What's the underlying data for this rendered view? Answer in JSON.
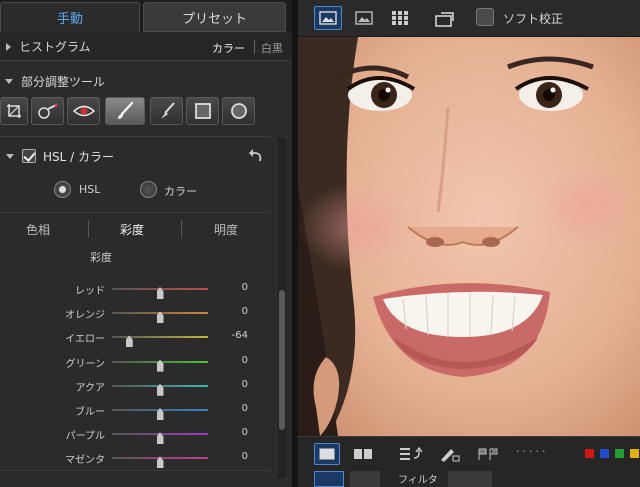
{
  "tabs": {
    "manual": "手動",
    "preset": "プリセット"
  },
  "histogram": {
    "label": "ヒストグラム",
    "color_option": "カラー",
    "bw_option": "白黒"
  },
  "local_adjust": {
    "label": "部分調整ツール"
  },
  "tools": [
    {
      "icon": "crop-icon"
    },
    {
      "icon": "redeye-brush-icon"
    },
    {
      "icon": "eye-icon"
    },
    {
      "icon": "brush-icon",
      "selected": true
    },
    {
      "icon": "eraser-brush-icon"
    },
    {
      "icon": "square-icon"
    },
    {
      "icon": "circle-icon"
    }
  ],
  "hsl_panel": {
    "title": "HSL / カラー",
    "radio_hsl": "HSL",
    "radio_color": "カラー",
    "subtab_hue": "色相",
    "subtab_saturation": "彩度",
    "subtab_lightness": "明度",
    "section_title": "彩度",
    "sliders": [
      {
        "label": "レッド",
        "value": "0",
        "level": 0,
        "color": "#c24b4b"
      },
      {
        "label": "オレンジ",
        "value": "0",
        "level": 0,
        "color": "#c8873a"
      },
      {
        "label": "イエロー",
        "value": "-64",
        "level": -64,
        "color": "#c2b83a"
      },
      {
        "label": "グリーン",
        "value": "0",
        "level": 0,
        "color": "#4fbf3a"
      },
      {
        "label": "アクア",
        "value": "0",
        "level": 0,
        "color": "#3ab8b8"
      },
      {
        "label": "ブルー",
        "value": "0",
        "level": 0,
        "color": "#3a7fc2"
      },
      {
        "label": "パープル",
        "value": "0",
        "level": 0,
        "color": "#a23ac2"
      },
      {
        "label": "マゼンタ",
        "value": "0",
        "level": 0,
        "color": "#c23a9b"
      }
    ]
  },
  "viewer": {
    "soft_proof_label": "ソフト校正",
    "color_labels": [
      "#d01818",
      "#2848d0",
      "#20a030",
      "#e0b010"
    ]
  },
  "bottom_partial": "フィルタ"
}
